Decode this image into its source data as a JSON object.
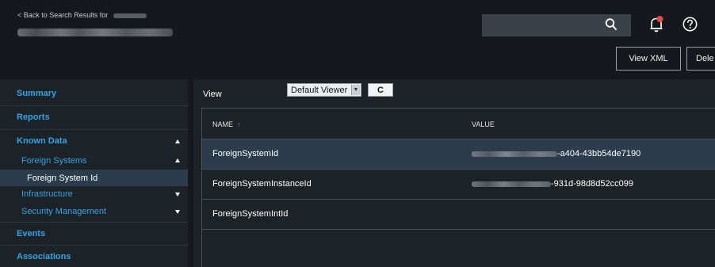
{
  "header": {
    "back_link": "< Back to Search Results for",
    "search": {
      "value": "",
      "placeholder": ""
    },
    "icons": {
      "search": "search-icon",
      "notifications": "bell-icon",
      "help": "help-icon"
    },
    "notification_dot_color": "#e84c4c",
    "buttons": {
      "view_xml": "View XML",
      "delete": "Dele"
    }
  },
  "sidebar": {
    "accent_color": "#2fa6e9",
    "items": [
      {
        "label": "Summary"
      },
      {
        "label": "Reports"
      },
      {
        "label": "Known Data",
        "expanded": true,
        "children": [
          {
            "label": "Foreign Systems",
            "expanded": true,
            "children": [
              {
                "label": "Foreign System Id",
                "selected": true
              }
            ]
          },
          {
            "label": "Infrastructure",
            "expanded": false
          },
          {
            "label": "Security Management",
            "expanded": false
          }
        ]
      },
      {
        "label": "Events"
      },
      {
        "label": "Associations"
      }
    ]
  },
  "main": {
    "view_label": "View",
    "viewer_select": {
      "selected": "Default Viewer"
    },
    "refresh_glyph": "C",
    "table": {
      "columns": {
        "name": "NAME",
        "name_sort_glyph": "↑",
        "value": "VALUE"
      },
      "rows": [
        {
          "name": "ForeignSystemId",
          "value_suffix": "-a404-43bb54de7190",
          "selected": true
        },
        {
          "name": "ForeignSystemInstanceId",
          "value_suffix": "-931d-98d8d52cc099",
          "selected": false
        },
        {
          "name": "ForeignSystemIntId",
          "value_suffix": "",
          "selected": false
        }
      ]
    }
  }
}
